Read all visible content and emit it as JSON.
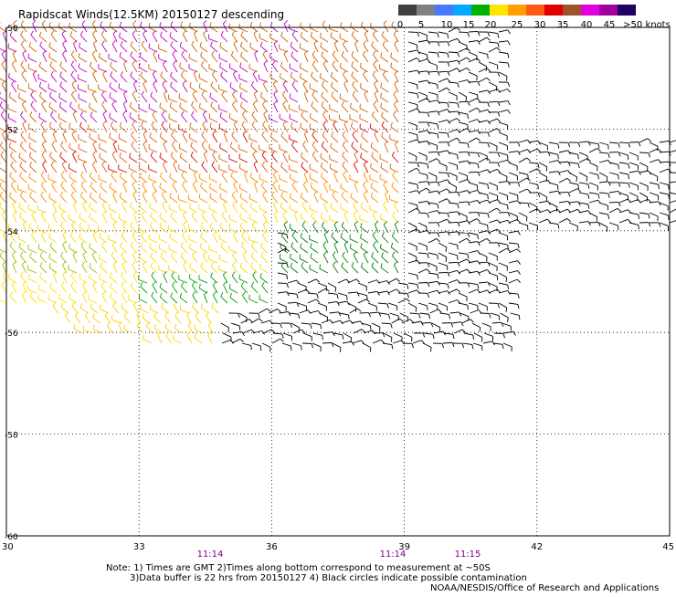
{
  "title": "Rapidscat Winds(12.5KM) 20150127 descending",
  "colorbar": {
    "labels": [
      "0",
      "5",
      "10",
      "15",
      "20",
      "25",
      "30",
      "35",
      "40",
      "45",
      ">50 knots"
    ],
    "colors": [
      "#404040",
      "#808080",
      "#4a78ff",
      "#00a8ff",
      "#00b000",
      "#ffe600",
      "#ffa000",
      "#ff5a14",
      "#e00000",
      "#a0522d",
      "#e000e0",
      "#a000a0",
      "#200060"
    ]
  },
  "map": {
    "lon_labels": [
      "30",
      "33",
      "36",
      "39",
      "42",
      "45"
    ],
    "lat_labels": [
      "-50",
      "-52",
      "-54",
      "-56",
      "-58",
      "-60"
    ],
    "grid_style": "dotted"
  },
  "times": [
    "11:14",
    "11:14",
    "11:15"
  ],
  "notes": [
    "Note: 1) Times are GMT 2)Times along bottom correspond to measurement at ~50S",
    "3)Data buffer is 22 hrs from 20150127 4) Black circles indicate possible contamination",
    "NOAA/NESDIS/Office of Research and Applications"
  ]
}
